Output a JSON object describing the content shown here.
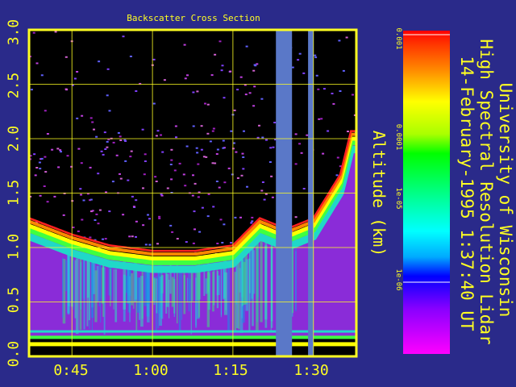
{
  "chart_data": {
    "type": "heatmap",
    "title": "Backscatter Cross Section",
    "xlabel": "",
    "ylabel": "Altitude (km)",
    "x_ticks": [
      "0:45",
      "1:00",
      "1:15",
      "1:30"
    ],
    "y_ticks": [
      "0.0",
      "0.5",
      "1.0",
      "1.5",
      "2.0",
      "2.5",
      "3.0"
    ],
    "xlim": [
      "0:37",
      "1:38"
    ],
    "ylim": [
      0.0,
      3.0
    ],
    "grid": true,
    "cloud_base_km": [
      {
        "time": "0:37",
        "alt": 1.2
      },
      {
        "time": "0:45",
        "alt": 1.05
      },
      {
        "time": "0:52",
        "alt": 0.95
      },
      {
        "time": "1:00",
        "alt": 0.9
      },
      {
        "time": "1:08",
        "alt": 0.9
      },
      {
        "time": "1:15",
        "alt": 0.95
      },
      {
        "time": "1:20",
        "alt": 1.2
      },
      {
        "time": "1:25",
        "alt": 1.1
      },
      {
        "time": "1:30",
        "alt": 1.2
      },
      {
        "time": "1:35",
        "alt": 1.6
      },
      {
        "time": "1:37",
        "alt": 2.0
      }
    ],
    "data_gaps": [
      {
        "start": "1:23",
        "end": "1:26"
      },
      {
        "start": "1:29",
        "end": "1:30"
      }
    ],
    "colorbar": {
      "scale": "log",
      "range": [
        1e-07,
        0.001
      ],
      "ticks": [
        "0.001",
        "0.0001",
        "1e-05",
        "1e-06"
      ]
    }
  },
  "header": {
    "line1": "University of Wisconsin",
    "line2": "High Spectral Resolution Lidar",
    "line3": "14-February-1995  1:37:40 UT"
  },
  "colors": {
    "background": "#2a2a8a",
    "text": "#ffff22",
    "frame": "#ffff22",
    "gap": "#5a78c8"
  }
}
